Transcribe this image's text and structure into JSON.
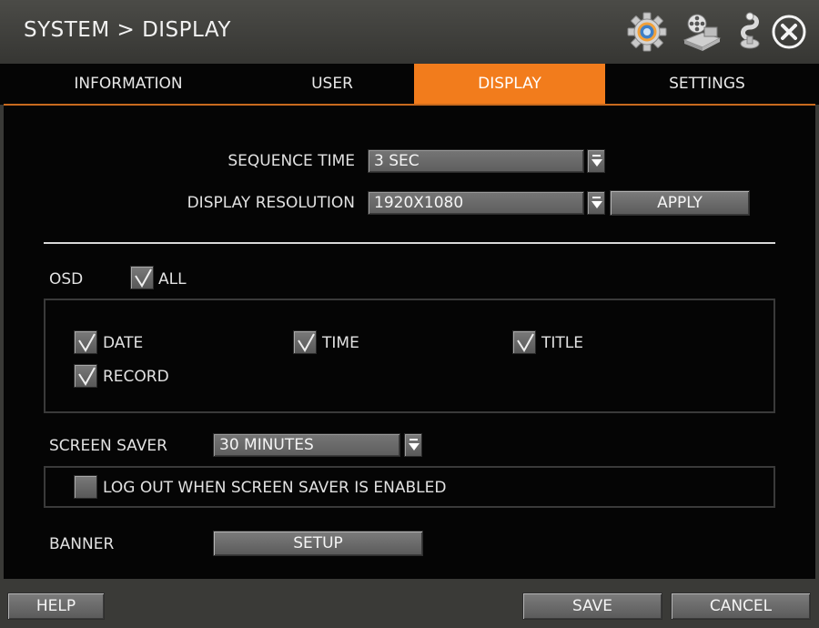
{
  "window": {
    "title": "SYSTEM > DISPLAY"
  },
  "header_icons": [
    "gear-icon",
    "film-reel-icon",
    "network-icon",
    "close-icon"
  ],
  "tabs": [
    {
      "label": "INFORMATION",
      "active": false
    },
    {
      "label": "USER",
      "active": false
    },
    {
      "label": "DISPLAY",
      "active": true
    },
    {
      "label": "SETTINGS",
      "active": false
    }
  ],
  "display": {
    "sequence_time": {
      "label": "SEQUENCE TIME",
      "value": "3 SEC"
    },
    "resolution": {
      "label": "DISPLAY RESOLUTION",
      "value": "1920X1080",
      "apply_label": "APPLY"
    }
  },
  "osd": {
    "label": "OSD",
    "all": {
      "label": "ALL",
      "checked": true
    },
    "items": [
      {
        "label": "DATE",
        "checked": true
      },
      {
        "label": "TIME",
        "checked": true
      },
      {
        "label": "TITLE",
        "checked": true
      },
      {
        "label": "RECORD",
        "checked": true
      }
    ]
  },
  "screen_saver": {
    "label": "SCREEN SAVER",
    "value": "30 MINUTES",
    "logout": {
      "label": "LOG OUT WHEN SCREEN SAVER IS ENABLED",
      "checked": false
    }
  },
  "banner": {
    "label": "BANNER",
    "setup_label": "SETUP"
  },
  "footer": {
    "help_label": "HELP",
    "save_label": "SAVE",
    "cancel_label": "CANCEL"
  },
  "colors": {
    "accent": "#f27c1c",
    "panel": "#050505",
    "chrome": "#3a3a37"
  }
}
